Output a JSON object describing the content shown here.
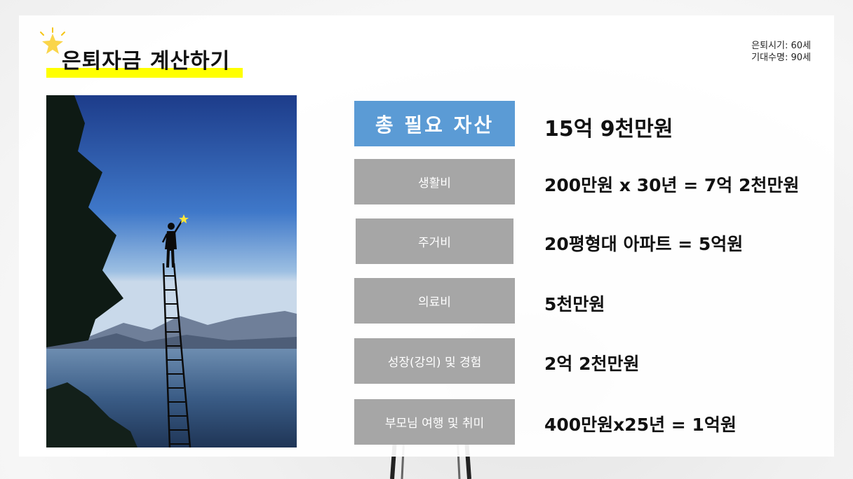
{
  "title": "은퇴자금 계산하기",
  "corner_note": {
    "retire_age": "은퇴시기: 60세",
    "life_expectancy": "기대수명: 90세"
  },
  "total": {
    "label": "총 필요 자산",
    "value": "15억 9천만원"
  },
  "items": [
    {
      "label": "생활비",
      "value": "200만원 x 30년  = 7억 2천만원"
    },
    {
      "label": "주거비",
      "value": "20평형대 아파트 = 5억원"
    },
    {
      "label": "의료비",
      "value": "5천만원"
    },
    {
      "label": "성장(강의) 및 경험",
      "value": "2억 2천만원"
    },
    {
      "label": "부모님 여행 및 취미",
      "value": "400만원x25년 = 1억원"
    }
  ],
  "colors": {
    "primary_box": "#5b9bd5",
    "item_box": "#a6a6a6",
    "highlight": "#ffff00"
  },
  "icons": [
    "star-icon"
  ]
}
